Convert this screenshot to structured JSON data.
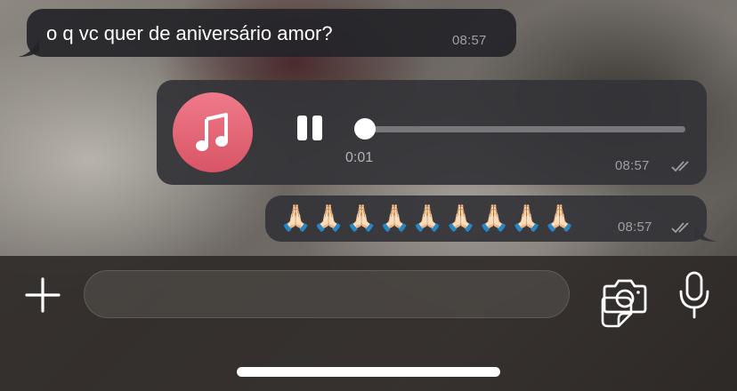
{
  "messages": [
    {
      "type": "text",
      "direction": "incoming",
      "text": "o q vc quer de aniversário amor?",
      "time": "08:57"
    },
    {
      "type": "audio",
      "direction": "outgoing",
      "icon": "music-note-icon",
      "elapsed": "0:01",
      "progress": 0.0,
      "time": "08:57",
      "status": "read"
    },
    {
      "type": "text",
      "direction": "outgoing",
      "text": "🙏🏻🙏🏻🙏🏻🙏🏻🙏🏻🙏🏻🙏🏻🙏🏻🙏🏻",
      "time": "08:57",
      "status": "read"
    }
  ],
  "input_bar": {
    "message_placeholder": "",
    "icons": [
      "plus-icon",
      "sticker-icon",
      "camera-icon",
      "microphone-icon"
    ]
  },
  "colors": {
    "bubble": "#242428",
    "audio_badge": "#e0606f",
    "timestamp": "#9e9ea4"
  }
}
